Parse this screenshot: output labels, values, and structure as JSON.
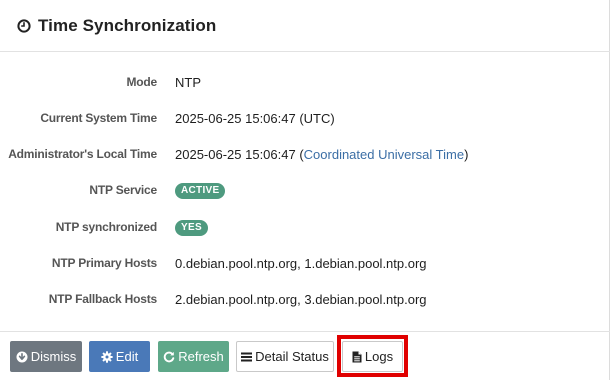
{
  "panel": {
    "title": "Time Synchronization",
    "icon": "clock-icon"
  },
  "rows": [
    {
      "label": "Mode",
      "value": "NTP"
    },
    {
      "label": "Current System Time",
      "value": "2025-06-25 15:06:47 (UTC)"
    },
    {
      "label": "Administrator's Local Time",
      "value_prefix": "2025-06-25 15:06:47 (",
      "value_link": "Coordinated Universal Time",
      "value_suffix": ")"
    },
    {
      "label": "NTP Service",
      "badge": "ACTIVE"
    },
    {
      "label": "NTP synchronized",
      "badge": "YES"
    },
    {
      "label": "NTP Primary Hosts",
      "value": "0.debian.pool.ntp.org, 1.debian.pool.ntp.org"
    },
    {
      "label": "NTP Fallback Hosts",
      "value": "2.debian.pool.ntp.org, 3.debian.pool.ntp.org"
    }
  ],
  "buttons": {
    "dismiss": "Dismiss",
    "edit": "Edit",
    "refresh": "Refresh",
    "detail_status": "Detail Status",
    "logs": "Logs"
  },
  "colors": {
    "badge": "#4e9a7f",
    "dismiss": "#6e7780",
    "edit": "#4a79b8",
    "refresh": "#5ea889",
    "highlight": "#e00000",
    "link": "#3b6ea5"
  }
}
